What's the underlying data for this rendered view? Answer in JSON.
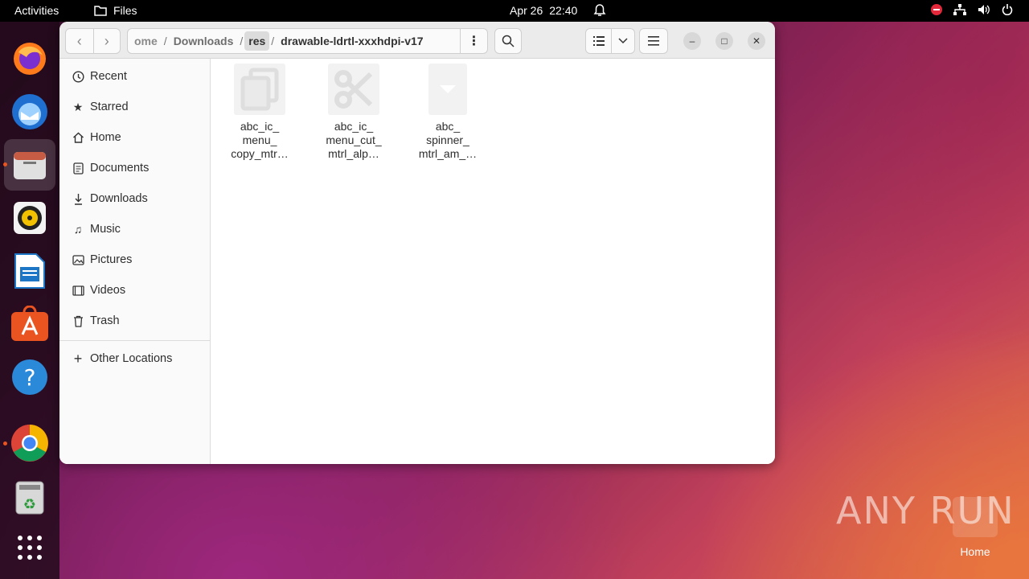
{
  "topbar": {
    "activities": "Activities",
    "app_name": "Files",
    "date": "Apr 26",
    "time": "22:40"
  },
  "dock": {
    "items": [
      "firefox",
      "thunderbird",
      "files",
      "rhythmbox",
      "libreoffice-writer",
      "app-center",
      "help",
      "chrome",
      "trash",
      "show-apps"
    ]
  },
  "headerbar": {
    "path": {
      "cut_segment": "ome",
      "segments": [
        "Downloads",
        "res",
        "drawable-ldrtl-xxxhdpi-v17"
      ],
      "separator": "/"
    },
    "menu_glyph": "⋮"
  },
  "sidebar": {
    "items": [
      {
        "label": "Recent",
        "icon": "clock-icon"
      },
      {
        "label": "Starred",
        "icon": "star-icon"
      },
      {
        "label": "Home",
        "icon": "home-icon"
      },
      {
        "label": "Documents",
        "icon": "document-icon"
      },
      {
        "label": "Downloads",
        "icon": "download-icon"
      },
      {
        "label": "Music",
        "icon": "music-icon"
      },
      {
        "label": "Pictures",
        "icon": "picture-icon"
      },
      {
        "label": "Videos",
        "icon": "video-icon"
      },
      {
        "label": "Trash",
        "icon": "trash-icon"
      }
    ],
    "other_locations": "Other Locations"
  },
  "files": [
    {
      "line1": "abc_ic_",
      "line2": "menu_",
      "line3": "copy_mtr…",
      "icon": "copy-icon"
    },
    {
      "line1": "abc_ic_",
      "line2": "menu_cut_",
      "line3": "mtrl_alp…",
      "icon": "scissors-icon"
    },
    {
      "line1": "abc_",
      "line2": "spinner_",
      "line3": "mtrl_am_…",
      "icon": "dropdown-triangle-icon"
    }
  ],
  "desktop": {
    "watermark": "ANY RUN",
    "home_label": "Home"
  },
  "colors": {
    "accent": "#e95420",
    "window_bg": "#ffffff",
    "headerbar_bg": "#ebebeb"
  }
}
